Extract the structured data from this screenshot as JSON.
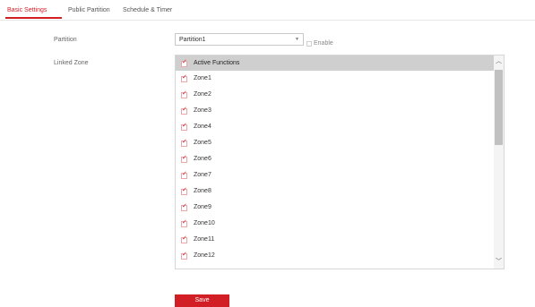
{
  "tabs": [
    {
      "label": "Basic Settings",
      "active": true
    },
    {
      "label": "Public Partition",
      "active": false
    },
    {
      "label": "Schedule & Timer",
      "active": false
    }
  ],
  "partition": {
    "label": "Partition",
    "selected": "Partition1",
    "enable_label": "Enable",
    "enable_checked": false
  },
  "linked_zone": {
    "label": "Linked Zone",
    "header_label": "Active Functions",
    "zones": [
      {
        "label": "Zone1",
        "checked": true
      },
      {
        "label": "Zone2",
        "checked": true
      },
      {
        "label": "Zone3",
        "checked": true
      },
      {
        "label": "Zone4",
        "checked": true
      },
      {
        "label": "Zone5",
        "checked": true
      },
      {
        "label": "Zone6",
        "checked": true
      },
      {
        "label": "Zone7",
        "checked": true
      },
      {
        "label": "Zone8",
        "checked": true
      },
      {
        "label": "Zone9",
        "checked": true
      },
      {
        "label": "Zone10",
        "checked": true
      },
      {
        "label": "Zone11",
        "checked": true
      },
      {
        "label": "Zone12",
        "checked": true
      }
    ]
  },
  "actions": {
    "save_label": "Save"
  },
  "colors": {
    "accent": "#d21f26",
    "header_bg": "#cfcfcf",
    "scroll_thumb": "#c1c1c1"
  },
  "icons": {
    "check": "check-icon",
    "dropdown": "chevron-down-icon",
    "scroll_up": "chevron-up-icon",
    "scroll_down": "chevron-down-icon"
  }
}
